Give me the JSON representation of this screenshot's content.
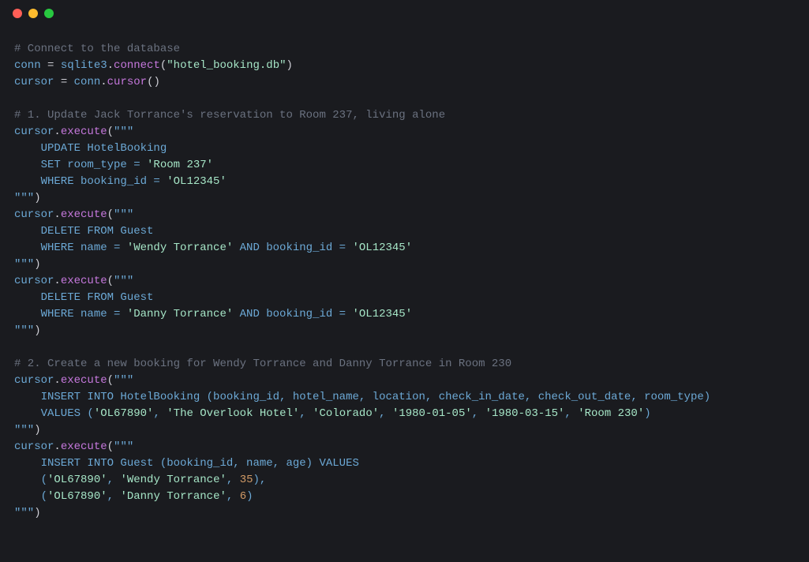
{
  "titlebar": {
    "dots": [
      "red",
      "yellow",
      "green"
    ]
  },
  "code": {
    "c1": "# Connect to the database",
    "l2_conn": "conn",
    "l2_eq": " = ",
    "l2_sqlite": "sqlite3",
    "l2_dot": ".",
    "l2_connect": "connect",
    "l2_op": "(",
    "l2_str": "\"hotel_booking.db\"",
    "l2_cp": ")",
    "l3_cursor": "cursor",
    "l3_eq": " = ",
    "l3_conn": "conn",
    "l3_dot": ".",
    "l3_cursorf": "cursor",
    "l3_par": "()",
    "c2": "# 1. Update Jack Torrance's reservation to Room 237, living alone",
    "ex_open": "cursor",
    "ex_dot": ".",
    "ex_exec": "execute",
    "ex_op": "(",
    "tq": "\"\"\"",
    "ex_cp": ")",
    "q1_l1": "    UPDATE HotelBooking",
    "q1_l2a": "    SET room_type = ",
    "q1_l2b": "'Room 237'",
    "q1_l3a": "    WHERE booking_id = ",
    "q1_l3b": "'OL12345'",
    "q2_l1": "    DELETE FROM Guest",
    "q2_l2a": "    WHERE name = ",
    "q2_l2b": "'Wendy Torrance'",
    "q2_l2c": " AND booking_id = ",
    "q2_l2d": "'OL12345'",
    "q3_l1": "    DELETE FROM Guest",
    "q3_l2a": "    WHERE name = ",
    "q3_l2b": "'Danny Torrance'",
    "q3_l2c": " AND booking_id = ",
    "q3_l2d": "'OL12345'",
    "c3": "# 2. Create a new booking for Wendy Torrance and Danny Torrance in Room 230",
    "q4_l1": "    INSERT INTO HotelBooking (booking_id, hotel_name, location, check_in_date, check_out_date, room_type)",
    "q4_l2a": "    VALUES (",
    "q4_l2b": "'OL67890'",
    "q4_l2c": ", ",
    "q4_l2d": "'The Overlook Hotel'",
    "q4_l2e": ", ",
    "q4_l2f": "'Colorado'",
    "q4_l2g": ", ",
    "q4_l2h": "'1980-01-05'",
    "q4_l2i": ", ",
    "q4_l2j": "'1980-03-15'",
    "q4_l2k": ", ",
    "q4_l2l": "'Room 230'",
    "q4_l2m": ")",
    "q5_l1": "    INSERT INTO Guest (booking_id, name, age) VALUES",
    "q5_l2a": "    (",
    "q5_l2b": "'OL67890'",
    "q5_l2c": ", ",
    "q5_l2d": "'Wendy Torrance'",
    "q5_l2e": ", ",
    "q5_l2f": "35",
    "q5_l2g": "),",
    "q5_l3a": "    (",
    "q5_l3b": "'OL67890'",
    "q5_l3c": ", ",
    "q5_l3d": "'Danny Torrance'",
    "q5_l3e": ", ",
    "q5_l3f": "6",
    "q5_l3g": ")"
  }
}
